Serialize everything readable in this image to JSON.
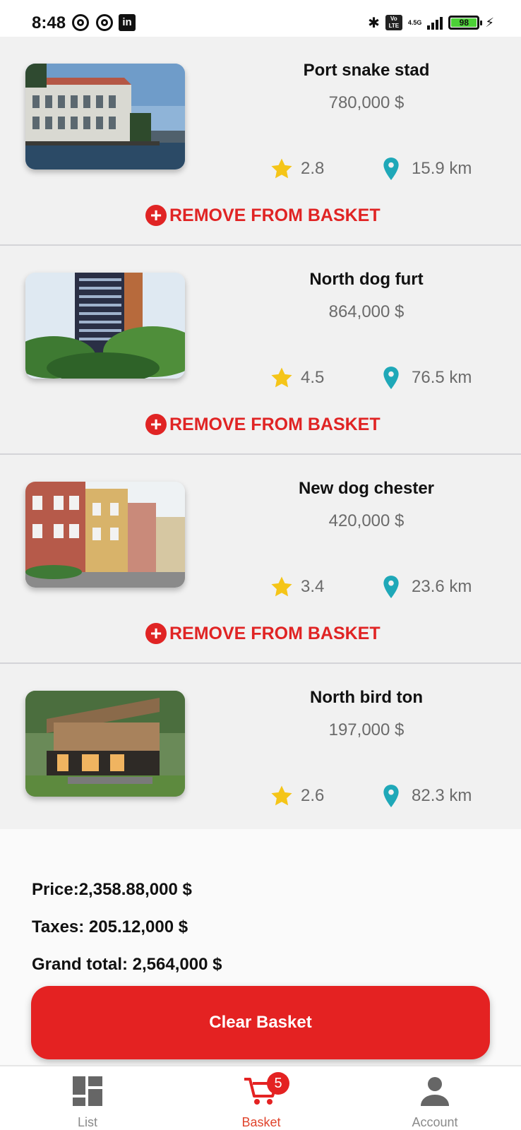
{
  "status_bar": {
    "time": "8:48",
    "network": "4.5G",
    "battery": "98",
    "volte": "Vo LTE"
  },
  "items": [
    {
      "title": "Port snake stad",
      "price": "780,000 $",
      "rating": "2.8",
      "distance": "15.9 km",
      "remove_label": "REMOVE FROM BASKET"
    },
    {
      "title": "North dog furt",
      "price": "864,000 $",
      "rating": "4.5",
      "distance": "76.5 km",
      "remove_label": "REMOVE FROM BASKET"
    },
    {
      "title": "New dog chester",
      "price": "420,000 $",
      "rating": "3.4",
      "distance": "23.6 km",
      "remove_label": "REMOVE FROM BASKET"
    },
    {
      "title": "North bird ton",
      "price": "197,000 $",
      "rating": "2.6",
      "distance": "82.3 km"
    }
  ],
  "totals": {
    "price": "Price:2,358.88,000 $",
    "taxes": "Taxes: 205.12,000 $",
    "grand_total": "Grand total: 2,564,000 $",
    "clear_label": "Clear Basket"
  },
  "nav": {
    "list_label": "List",
    "basket_label": "Basket",
    "basket_count": "5",
    "account_label": "Account"
  },
  "colors": {
    "accent": "#e42222",
    "star": "#f5c518",
    "pin": "#1fa8b8",
    "card_bg": "#f1f1f1"
  }
}
